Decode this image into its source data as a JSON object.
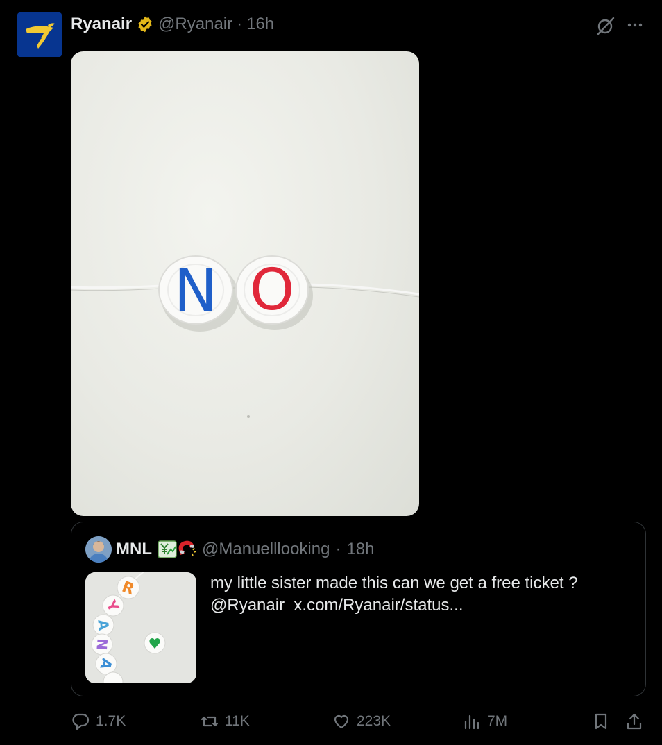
{
  "tweet": {
    "author_name": "Ryanair",
    "author_handle": "@Ryanair",
    "separator": "·",
    "time": "16h",
    "media_text": [
      "N",
      "O"
    ]
  },
  "quoted": {
    "author_name": "MNL",
    "author_handle": "@Manuelllooking",
    "separator": "·",
    "time": "18h",
    "text": "my little sister made this can we get a free ticket ?",
    "mention": "@Ryanair",
    "link": "x.com/Ryanair/status...",
    "thumb_letters": [
      "R",
      "Y",
      "A",
      "N",
      "A"
    ]
  },
  "actions": {
    "replies": "1.7K",
    "reposts": "11K",
    "likes": "223K",
    "views": "7M"
  },
  "colors": {
    "background": "#000000",
    "text": "#e7e9ea",
    "muted": "#71767b",
    "border": "#2f3336",
    "verified": "#e2b719",
    "ryanair_blue": "#073590",
    "ryanair_yellow": "#f1c933"
  }
}
